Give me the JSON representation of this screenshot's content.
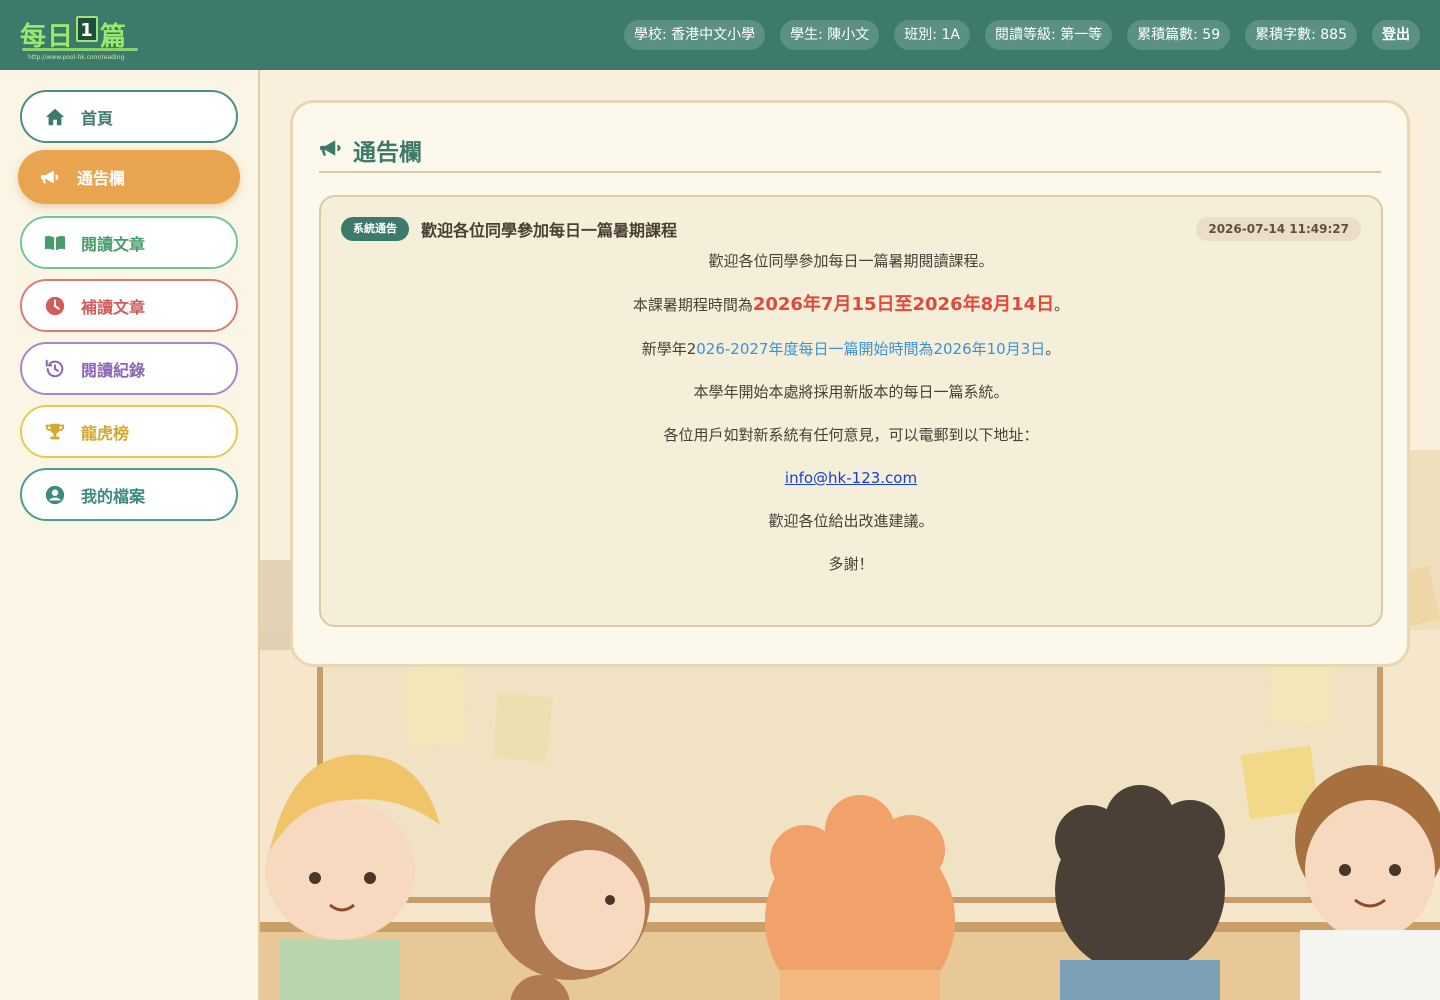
{
  "header": {
    "logo": {
      "char1": "每",
      "char2": "日",
      "num": "1",
      "char3": "篇",
      "url": "http://www.pool-hk.com/reading"
    },
    "info": [
      {
        "key": "school",
        "text": "學校: 香港中文小學"
      },
      {
        "key": "student",
        "text": "學生: 陳小文"
      },
      {
        "key": "class",
        "text": "班別: 1A"
      },
      {
        "key": "level",
        "text": "閱讀等級: 第一等"
      },
      {
        "key": "articles",
        "text": "累積篇數: 59"
      },
      {
        "key": "words",
        "text": "累積字數: 885"
      }
    ],
    "logout_label": "登出"
  },
  "sidebar": {
    "items": [
      {
        "label": "首頁",
        "icon": "home-icon"
      },
      {
        "label": "通告欄",
        "icon": "megaphone-icon",
        "active": true
      },
      {
        "label": "閱讀文章",
        "icon": "book-icon"
      },
      {
        "label": "補讀文章",
        "icon": "clock-icon"
      },
      {
        "label": "閱讀紀錄",
        "icon": "history-icon"
      },
      {
        "label": "龍虎榜",
        "icon": "trophy-icon"
      },
      {
        "label": "我的檔案",
        "icon": "user-circle-icon"
      }
    ]
  },
  "panel": {
    "title": "通告欄",
    "notice": {
      "badge": "系統通告",
      "title": "歡迎各位同學參加每日一篇暑期課程",
      "time": "2026-07-14 11:49:27",
      "lines": {
        "l1": "歡迎各位同學參加每日一篇暑期閱讀課程。",
        "l2_pre": "本課暑期程時間為",
        "l2_highlight": "2026年7月15日至2026年8月14日",
        "l2_post": "。",
        "l3_pre": "新學年2",
        "l3_highlight": "026-2027年度每日一篇開始時間為2026年10月3日",
        "l3_post": "。",
        "l4": "本學年開始本處將採用新版本的每日一篇系統。",
        "l5": "各位用戶如對新系統有任何意見，可以電郵到以下地址：",
        "email": "info@hk-123.com",
        "l7": "歡迎各位給出改進建議。",
        "l8": "多謝！"
      }
    }
  },
  "colors": {
    "topbar": "#3d7a6b",
    "accent_orange": "#e8a44e",
    "highlight_red": "#e04a3a",
    "highlight_blue": "#3b92d6"
  }
}
